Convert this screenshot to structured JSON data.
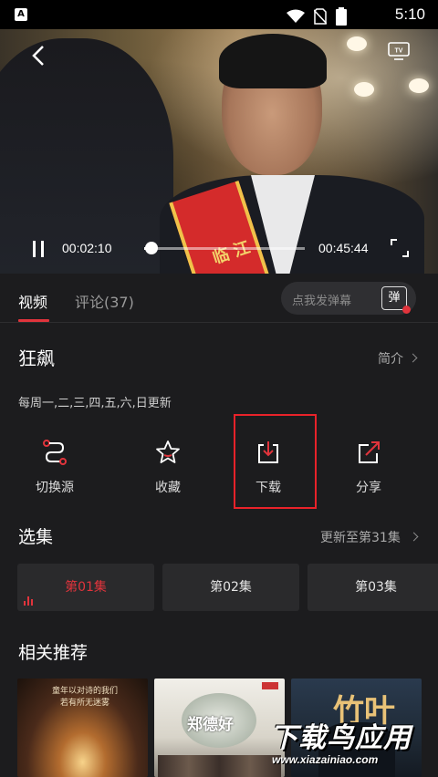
{
  "status_bar": {
    "app_badge": "A",
    "time": "5:10"
  },
  "player": {
    "sash_text": "临江",
    "current_time": "00:02:10",
    "total_time": "00:45:44",
    "progress": 0.047,
    "tv_label": "TV"
  },
  "tabs": [
    {
      "label": "视频",
      "active": true
    },
    {
      "label": "评论(37)",
      "active": false
    }
  ],
  "danmu": {
    "placeholder": "点我发弹幕",
    "button_label": "弹"
  },
  "show": {
    "title": "狂飙",
    "intro_link": "简介",
    "schedule": "每周一,二,三,四,五,六,日更新"
  },
  "actions": [
    {
      "label": "切换源",
      "icon": "switch-source-icon"
    },
    {
      "label": "收藏",
      "icon": "star-icon"
    },
    {
      "label": "下载",
      "icon": "download-icon"
    },
    {
      "label": "分享",
      "icon": "share-icon"
    }
  ],
  "episodes": {
    "section_title": "选集",
    "update_text": "更新至第31集",
    "items": [
      {
        "label": "第01集",
        "active": true
      },
      {
        "label": "第02集",
        "active": false
      },
      {
        "label": "第03集",
        "active": false
      }
    ]
  },
  "recommend": {
    "section_title": "相关推荐",
    "items": [
      {
        "poster_text": "童年以对诗的我们 若有所无迷雾"
      },
      {
        "poster_title": "郑德好"
      },
      {
        "poster_title": "竹叶"
      }
    ]
  },
  "watermark": {
    "title": "下载鸟应用",
    "url": "www.xiazainiao.com"
  },
  "colors": {
    "accent": "#e1343c",
    "highlight_box": "#e8222a",
    "background": "#1c1c1e"
  }
}
